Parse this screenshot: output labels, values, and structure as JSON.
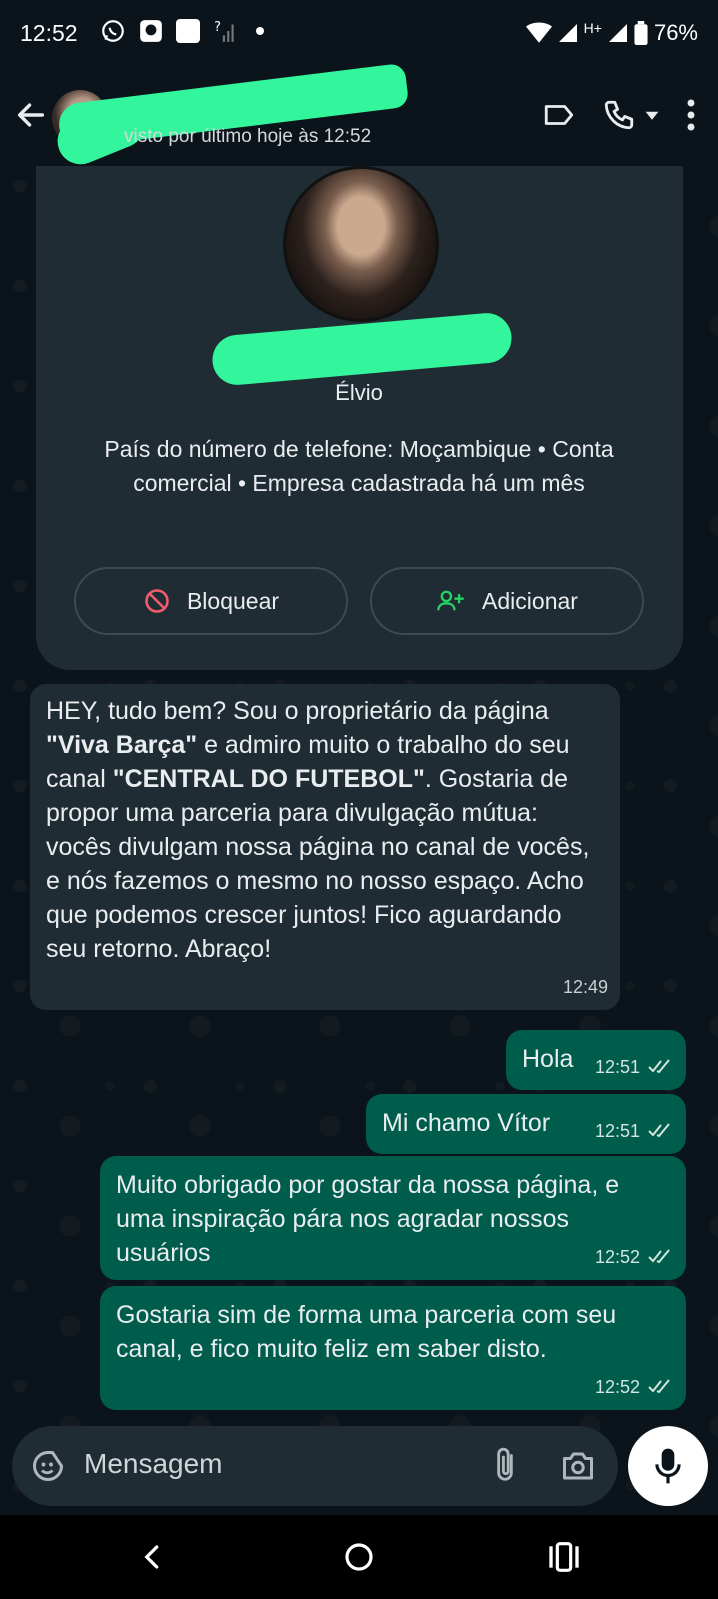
{
  "status_bar": {
    "time": "12:52",
    "network": "H+",
    "battery": "76%"
  },
  "header": {
    "last_seen": "visto por último hoje às 12:52"
  },
  "business_card": {
    "name": "Élvio",
    "info": "País do número de telefone: Moçambique • Conta comercial • Empresa cadastrada há um mês",
    "block_label": "Bloquear",
    "add_label": "Adicionar"
  },
  "messages": [
    {
      "direction": "in",
      "parts": [
        {
          "t": "HEY, tudo bem? Sou o proprietário da página "
        },
        {
          "t": "\"Viva Barça\"",
          "b": true
        },
        {
          "t": " e admiro muito o trabalho do seu canal "
        },
        {
          "t": "\"CENTRAL DO FUTEBOL\"",
          "b": true
        },
        {
          "t": ". Gostaria de propor uma parceria para divulgação mútua: vocês divulgam nossa página no canal de vocês, e nós fazemos o mesmo no nosso espaço. Acho que podemos crescer juntos! Fico aguardando seu retorno. Abraço!"
        }
      ],
      "time": "12:49"
    },
    {
      "direction": "out",
      "text": "Hola",
      "time": "12:51"
    },
    {
      "direction": "out",
      "text": "Mi chamo Vítor",
      "time": "12:51"
    },
    {
      "direction": "out",
      "text": "Muito obrigado por gostar da nossa página, e uma inspiração pára nos agradar nossos usuários",
      "time": "12:52"
    },
    {
      "direction": "out",
      "text": "Gostaria sim de forma uma parceria com seu canal, e fico muito feliz em saber disto.",
      "time": "12:52"
    }
  ],
  "composer": {
    "placeholder": "Mensagem"
  },
  "colors": {
    "background": "#0b141a",
    "incoming": "#202c33",
    "outgoing": "#005c4b",
    "redaction": "#33f59c",
    "add_icon": "#25d366",
    "block_icon": "#f15c6d"
  }
}
